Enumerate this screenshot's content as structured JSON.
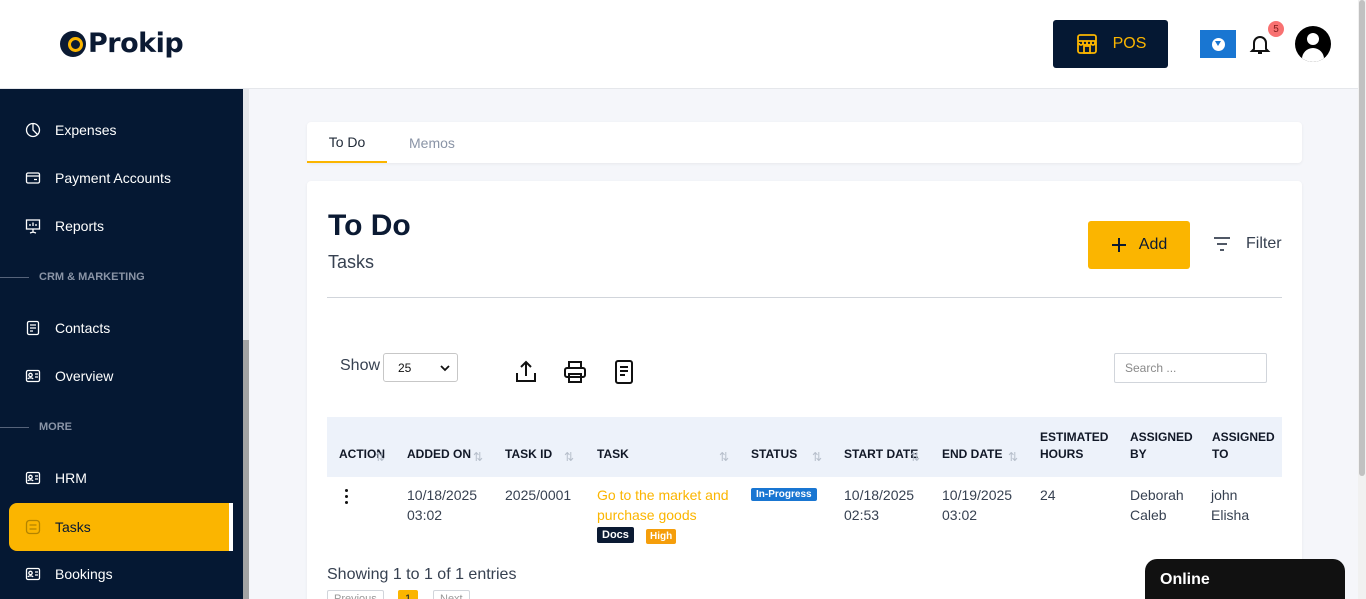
{
  "brand": {
    "logo_text": "Prokip",
    "accent": "#fbb500",
    "navy": "#051833"
  },
  "header": {
    "pos_label": "POS",
    "notification_count": "5",
    "icons": [
      "store-icon",
      "download-icon",
      "bell-icon",
      "user-avatar-icon"
    ]
  },
  "sidebar": {
    "items": [
      {
        "label": "Expenses",
        "icon": "pie-chart-icon"
      },
      {
        "label": "Payment Accounts",
        "icon": "wallet-icon"
      },
      {
        "label": "Reports",
        "icon": "presentation-icon"
      },
      {
        "label": "Contacts",
        "icon": "contacts-icon"
      },
      {
        "label": "Overview",
        "icon": "id-card-icon"
      },
      {
        "label": "HRM",
        "icon": "id-card-icon"
      },
      {
        "label": "Tasks",
        "icon": "tasks-icon",
        "active": true
      },
      {
        "label": "Bookings",
        "icon": "id-card-icon"
      }
    ],
    "sections": {
      "crm": "CRM & MARKETING",
      "more": "MORE"
    }
  },
  "tabs": [
    {
      "label": "To Do",
      "active": true
    },
    {
      "label": "Memos",
      "active": false
    }
  ],
  "page": {
    "title": "To Do",
    "subtitle": "Tasks",
    "add_label": "Add",
    "filter_label": "Filter"
  },
  "table_controls": {
    "show_label": "Show",
    "page_size": "25",
    "search_placeholder": "Search ...",
    "tools": [
      "export-icon",
      "print-icon",
      "document-icon"
    ]
  },
  "table": {
    "columns": [
      "ACTION",
      "ADDED ON",
      "TASK ID",
      "TASK",
      "STATUS",
      "START DATE",
      "END DATE",
      "ESTIMATED HOURS",
      "ASSIGNED BY",
      "ASSIGNED TO"
    ],
    "rows": [
      {
        "added_on": "10/18/2025 03:02",
        "task_id": "2025/0001",
        "task": "Go to the market and purchase goods",
        "tags": [
          "Docs",
          "High"
        ],
        "status": "In-Progress",
        "start_date": "10/18/2025 02:53",
        "end_date": "10/19/2025 03:02",
        "estimated_hours": "24",
        "assigned_by": "Deborah Caleb",
        "assigned_to": "john Elisha"
      }
    ],
    "status_color": "#1976d2",
    "tag_colors": {
      "Docs": "#0b1a33",
      "High": "#f59e0b"
    }
  },
  "footer": {
    "entries": "Showing 1 to 1 of 1 entries",
    "pager": {
      "previous": "Previous",
      "current": "1",
      "next": "Next"
    },
    "chat_status": "Online"
  }
}
